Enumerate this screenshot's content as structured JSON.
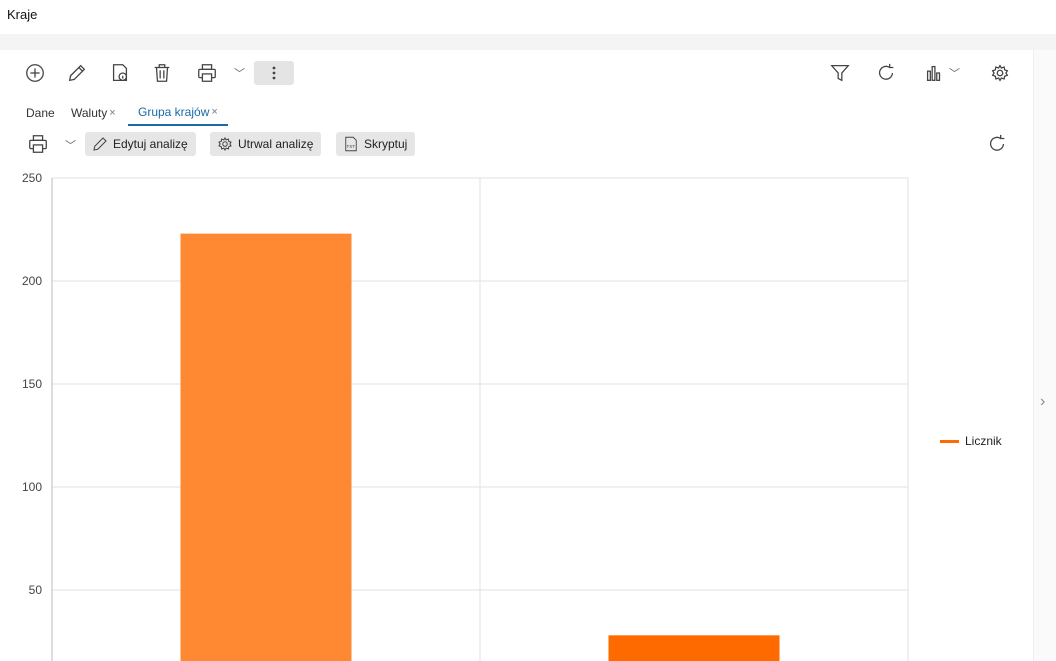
{
  "window": {
    "title": "Kraje"
  },
  "toolbar": {
    "icons": [
      "add-icon",
      "edit-icon",
      "details-icon",
      "trash-icon",
      "printer-icon",
      "chevron-down-icon",
      "more-vertical-icon",
      "filter-icon",
      "refresh-icon",
      "chart-icon",
      "gear-icon"
    ]
  },
  "tabs": [
    {
      "label": "Dane",
      "closable": false,
      "active": false
    },
    {
      "label": "Waluty",
      "closable": true,
      "active": false
    },
    {
      "label": "Grupa krajów",
      "closable": true,
      "active": true
    }
  ],
  "tab_close_glyph": "×",
  "analysis_toolbar": {
    "edit_label": "Edytuj analizę",
    "save_label": "Utrwal analizę",
    "script_label": "Skryptuj"
  },
  "colors": {
    "accent": "#1a6aa6",
    "bar1": "#ff8833",
    "bar2": "#ff6a00",
    "grid": "#e2e2e2"
  },
  "chart_data": {
    "type": "bar",
    "categories": [
      "",
      ""
    ],
    "series": [
      {
        "name": "Licznik",
        "values": [
          223,
          28
        ]
      }
    ],
    "ylim": [
      0,
      250
    ],
    "yticks": [
      50,
      100,
      150,
      200,
      250
    ],
    "grid": true,
    "legend_position": "right",
    "title": "",
    "xlabel": "",
    "ylabel": ""
  }
}
